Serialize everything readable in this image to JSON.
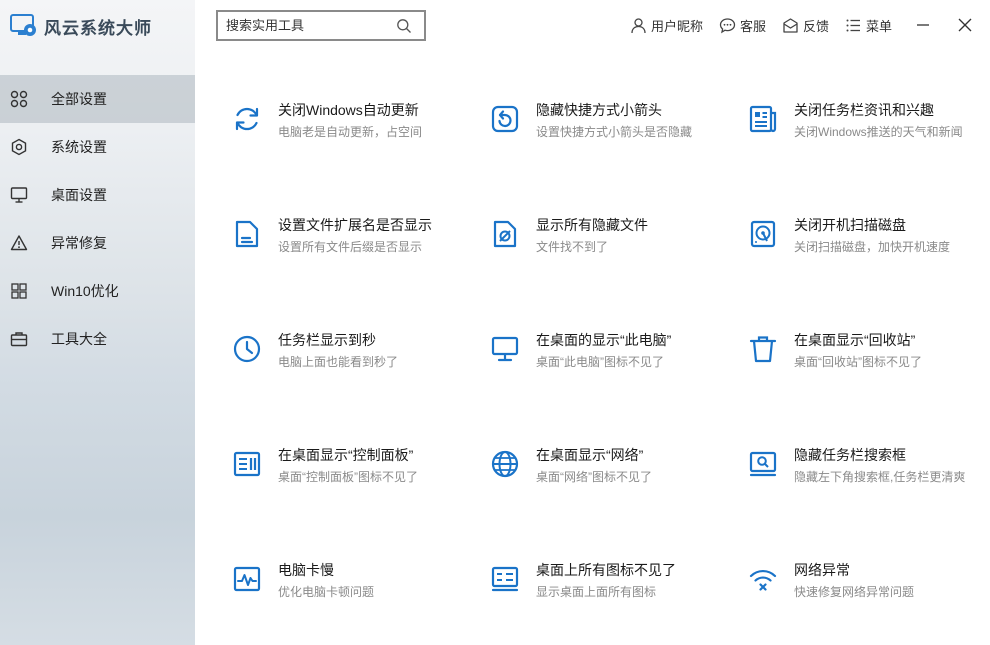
{
  "app": {
    "title": "风云系统大师"
  },
  "search": {
    "placeholder": "搜索实用工具"
  },
  "topbar": {
    "user_label": "用户昵称",
    "service_label": "客服",
    "feedback_label": "反馈",
    "menu_label": "菜单"
  },
  "sidebar": {
    "items": [
      {
        "label": "全部设置",
        "icon": "grid-icon",
        "active": true
      },
      {
        "label": "系统设置",
        "icon": "settings-icon",
        "active": false
      },
      {
        "label": "桌面设置",
        "icon": "monitor-icon",
        "active": false
      },
      {
        "label": "异常修复",
        "icon": "warning-icon",
        "active": false
      },
      {
        "label": "Win10优化",
        "icon": "windows-icon",
        "active": false
      },
      {
        "label": "工具大全",
        "icon": "toolbox-icon",
        "active": false
      }
    ]
  },
  "tools": [
    {
      "title": "关闭Windows自动更新",
      "desc": "电脑老是自动更新，占空间",
      "icon": "refresh-icon"
    },
    {
      "title": "隐藏快捷方式小箭头",
      "desc": "设置快捷方式小箭头是否隐藏",
      "icon": "shortcut-arrow-icon"
    },
    {
      "title": "关闭任务栏资讯和兴趣",
      "desc": "关闭Windows推送的天气和新闻",
      "icon": "news-icon"
    },
    {
      "title": "设置文件扩展名是否显示",
      "desc": "设置所有文件后缀是否显示",
      "icon": "file-extension-icon"
    },
    {
      "title": "显示所有隐藏文件",
      "desc": "文件找不到了",
      "icon": "hidden-file-icon"
    },
    {
      "title": "关闭开机扫描磁盘",
      "desc": "关闭扫描磁盘，加快开机速度",
      "icon": "disk-scan-icon"
    },
    {
      "title": "任务栏显示到秒",
      "desc": "电脑上面也能看到秒了",
      "icon": "clock-icon"
    },
    {
      "title": "在桌面的显示“此电脑”",
      "desc": "桌面“此电脑”图标不见了",
      "icon": "computer-icon"
    },
    {
      "title": "在桌面显示“回收站”",
      "desc": "桌面“回收站”图标不见了",
      "icon": "recycle-bin-icon"
    },
    {
      "title": "在桌面显示“控制面板”",
      "desc": "桌面“控制面板”图标不见了",
      "icon": "control-panel-icon"
    },
    {
      "title": "在桌面显示“网络”",
      "desc": "桌面“网络”图标不见了",
      "icon": "globe-icon"
    },
    {
      "title": "隐藏任务栏搜索框",
      "desc": "隐藏左下角搜索框,任务栏更清爽",
      "icon": "search-box-icon"
    },
    {
      "title": "电脑卡慢",
      "desc": "优化电脑卡顿问题",
      "icon": "pulse-icon"
    },
    {
      "title": "桌面上所有图标不见了",
      "desc": "显示桌面上面所有图标",
      "icon": "desktop-icons-icon"
    },
    {
      "title": "网络异常",
      "desc": "快速修复网络异常问题",
      "icon": "wifi-error-icon"
    }
  ],
  "colors": {
    "accent": "#1a73c8",
    "sidebar_active": "#b8c0c8"
  }
}
